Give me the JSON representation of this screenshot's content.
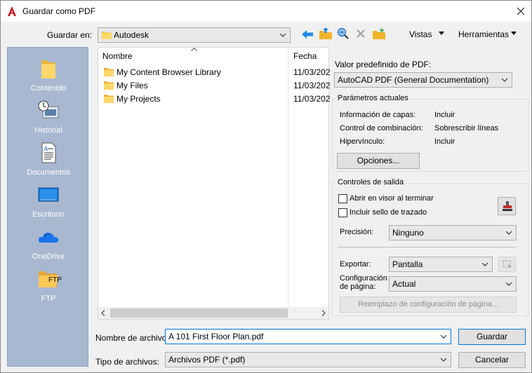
{
  "window": {
    "title": "Guardar como PDF"
  },
  "toolbar": {
    "save_in_label": "Guardar en:",
    "save_in_value": "Autodesk",
    "views_label": "Vistas",
    "tools_label": "Herramientas"
  },
  "places": [
    {
      "label": "Contenido",
      "icon": "folder-icon"
    },
    {
      "label": "Historial",
      "icon": "history-icon"
    },
    {
      "label": "Documentos",
      "icon": "documents-icon"
    },
    {
      "label": "Escritorio",
      "icon": "desktop-icon"
    },
    {
      "label": "OneDrive",
      "icon": "onedrive-icon"
    },
    {
      "label": "FTP",
      "icon": "ftp-folder-icon",
      "badge": "FTP"
    }
  ],
  "file_list": {
    "columns": [
      "Nombre",
      "Fecha de"
    ],
    "rows": [
      {
        "name": "My Content Browser Library",
        "date": "11/03/202"
      },
      {
        "name": "My Files",
        "date": "11/03/202"
      },
      {
        "name": "My Projects",
        "date": "11/03/202"
      }
    ]
  },
  "pdf": {
    "preset_label": "Valor predefinido de PDF:",
    "preset_value": "AutoCAD PDF (General Documentation)",
    "current_params_title": "Parámetros actuales",
    "params": [
      {
        "name": "Información de capas:",
        "value": "Incluir"
      },
      {
        "name": "Control de combinación:",
        "value": "Sobrescribir líneas"
      },
      {
        "name": "Hipervínculo:",
        "value": "Incluir"
      }
    ],
    "options_button": "Opciones...",
    "output_title": "Controles de salida",
    "open_viewer": "Abrir en visor al terminar",
    "include_stamp": "Incluir sello de trazado",
    "precision_label": "Precisión:",
    "precision_value": "Ninguno",
    "export_label": "Exportar:",
    "export_value": "Pantalla",
    "page_setup_label_1": "Configuración",
    "page_setup_label_2": "de página:",
    "page_setup_value": "Actual",
    "override_button": "Reemplazo de configuración de página..."
  },
  "footer": {
    "filename_label": "Nombre de archivo:",
    "filename_value": "A 101 First Floor Plan.pdf",
    "filetype_label": "Tipo de archivos:",
    "filetype_value": "Archivos PDF (*.pdf)",
    "save_button": "Guardar",
    "cancel_button": "Cancelar"
  }
}
